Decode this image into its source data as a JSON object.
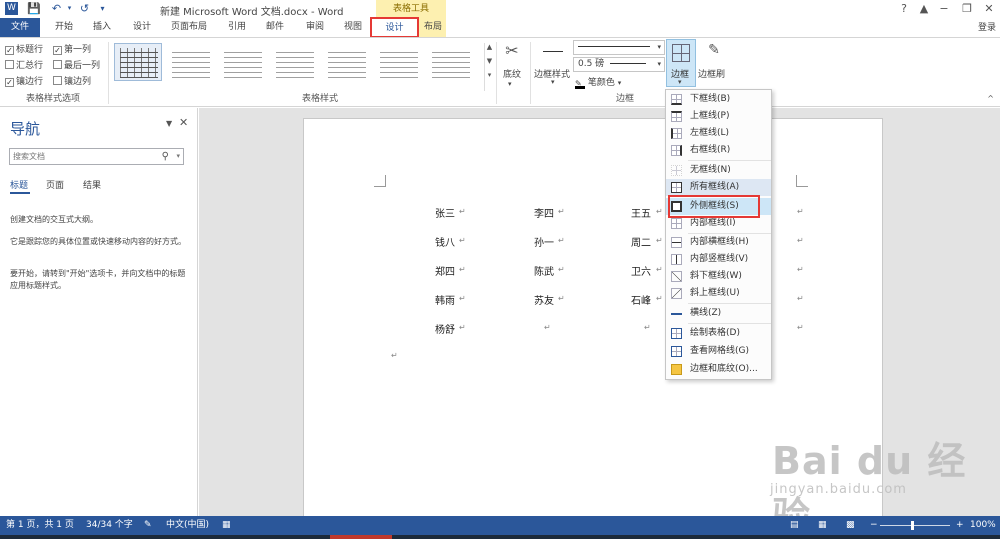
{
  "window": {
    "title": "新建 Microsoft Word 文档.docx - Word",
    "context_group": "表格工具",
    "login": "登录",
    "buttons": [
      "?",
      "−",
      "❐",
      "✕"
    ]
  },
  "tabs": [
    "文件",
    "开始",
    "插入",
    "设计",
    "页面布局",
    "引用",
    "邮件",
    "审阅",
    "视图",
    "设计",
    "布局"
  ],
  "ribbon": {
    "style_options": {
      "items": [
        {
          "label": "标题行",
          "checked": true
        },
        {
          "label": "第一列",
          "checked": true
        },
        {
          "label": "汇总行",
          "checked": false
        },
        {
          "label": "最后一列",
          "checked": false
        },
        {
          "label": "镶边行",
          "checked": true
        },
        {
          "label": "镶边列",
          "checked": false
        }
      ],
      "group_label": "表格样式选项"
    },
    "table_styles": {
      "group_label": "表格样式"
    },
    "shading_label": "底纹",
    "border_style_label": "边框样式",
    "pen_weight": "0.5 磅",
    "pen_color_label": "笔颜色",
    "borders_label": "边框",
    "border_painter_label": "边框刷",
    "border_group_label": "边框"
  },
  "nav": {
    "title": "导航",
    "search_placeholder": "搜索文档",
    "tabs": [
      "标题",
      "页面",
      "结果"
    ],
    "text1": "创建文档的交互式大纲。",
    "text2": "它是跟踪您的具体位置或快速移动内容的好方式。",
    "text3": "要开始，请转到\"开始\"选项卡，并向文档中的标题应用标题样式。"
  },
  "table": {
    "rows": [
      [
        "张三",
        "李四",
        "王五"
      ],
      [
        "钱八",
        "孙一",
        "周二"
      ],
      [
        "郑四",
        "陈武",
        "卫六"
      ],
      [
        "韩雨",
        "苏友",
        "石峰"
      ],
      [
        "杨舒",
        "",
        ""
      ]
    ]
  },
  "border_menu": {
    "items": [
      "下框线(B)",
      "上框线(P)",
      "左框线(L)",
      "右框线(R)",
      "无框线(N)",
      "所有框线(A)",
      "外侧框线(S)",
      "内部框线(I)",
      "内部横框线(H)",
      "内部竖框线(V)",
      "斜下框线(W)",
      "斜上框线(U)",
      "横线(Z)",
      "绘制表格(D)",
      "查看网格线(G)",
      "边框和底纹(O)..."
    ],
    "highlighted": "外侧框线(S)",
    "selected": "所有框线(A)"
  },
  "status": {
    "page": "第 1 页，共 1 页",
    "words": "34/34 个字",
    "lang": "中文(中国)",
    "zoom": "100%"
  },
  "watermark": {
    "logo": "Bai du 经验",
    "url": "jingyan.baidu.com"
  }
}
